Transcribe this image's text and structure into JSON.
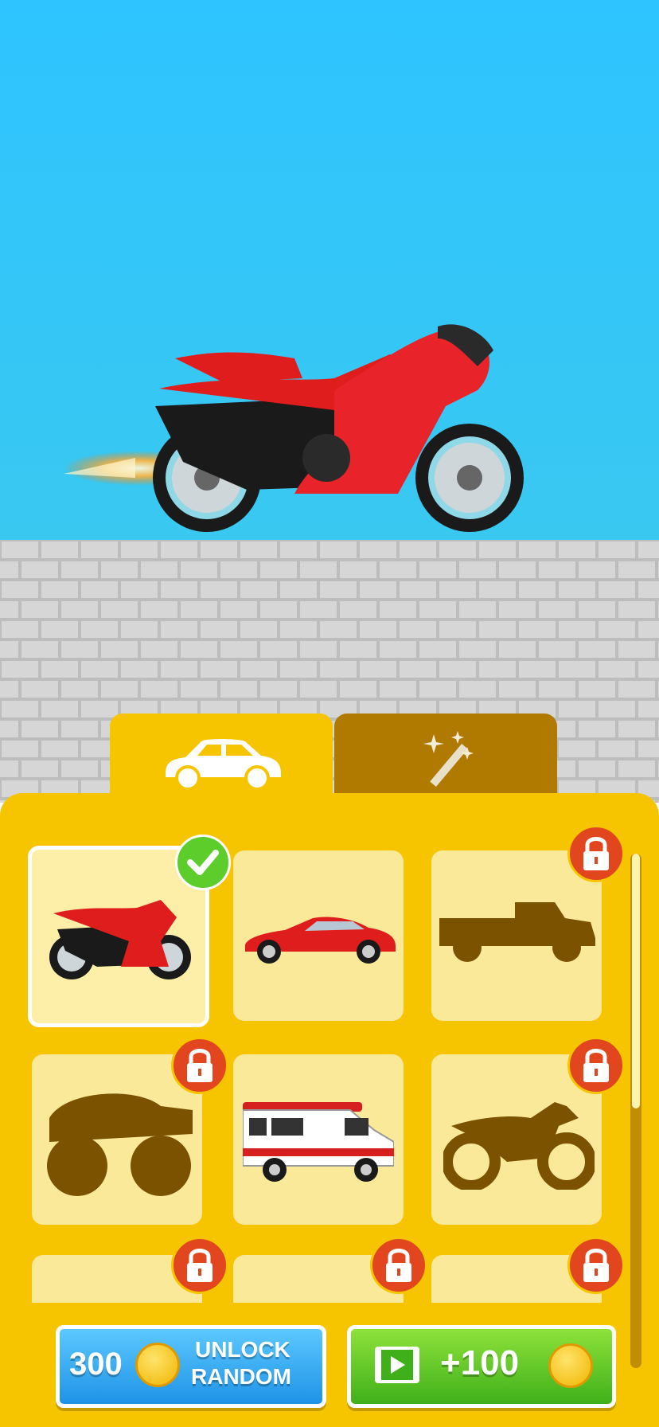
{
  "tabs": [
    {
      "name": "vehicles",
      "icon": "car-icon",
      "active": true
    },
    {
      "name": "effects",
      "icon": "magic-wand-icon",
      "active": false
    }
  ],
  "vehicles": [
    {
      "name": "sport-bike",
      "locked": false,
      "selected": true
    },
    {
      "name": "sports-car",
      "locked": false,
      "selected": false
    },
    {
      "name": "pickup-truck",
      "locked": true,
      "selected": false
    },
    {
      "name": "monster-truck",
      "locked": true,
      "selected": false
    },
    {
      "name": "ambulance-van",
      "locked": false,
      "selected": false
    },
    {
      "name": "dirt-bike",
      "locked": true,
      "selected": false
    },
    {
      "name": "vehicle-7",
      "locked": true,
      "selected": false
    },
    {
      "name": "vehicle-8",
      "locked": true,
      "selected": false
    },
    {
      "name": "vehicle-9",
      "locked": true,
      "selected": false
    }
  ],
  "buttons": {
    "unlock_cost": "300",
    "unlock_label_line1": "UNLOCK",
    "unlock_label_line2": "RANDOM",
    "reward_amount": "+100"
  },
  "colors": {
    "sky": "#2ec4ff",
    "panel": "#f7c400",
    "card": "#fbe99a",
    "locked_silhouette": "#7a5200",
    "lock_badge": "#e2461e",
    "check_badge": "#5ccd2a",
    "unlock_button": "#1f93e6",
    "ad_button": "#3fb01a"
  }
}
